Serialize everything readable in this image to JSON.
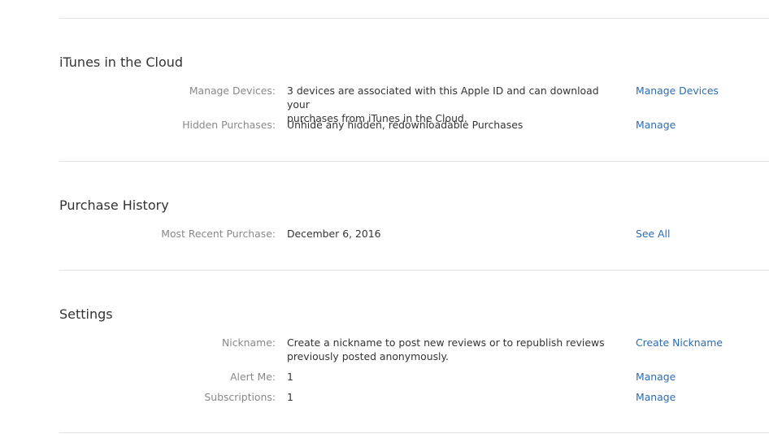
{
  "sections": {
    "itunes_cloud": {
      "title": "iTunes in the Cloud",
      "rows": [
        {
          "label": "Manage Devices:",
          "value_line1": "3 devices are associated with this Apple ID and can download your",
          "value_line2": "purchases from iTunes in the Cloud.",
          "link": "Manage Devices"
        },
        {
          "label": "Hidden Purchases:",
          "value_line1": "Unhide any hidden, redownloadable Purchases",
          "link": "Manage"
        }
      ]
    },
    "purchase_history": {
      "title": "Purchase History",
      "rows": [
        {
          "label": "Most Recent Purchase:",
          "value_line1": "December 6, 2016",
          "link": "See All"
        }
      ]
    },
    "settings": {
      "title": "Settings",
      "rows": [
        {
          "label": "Nickname:",
          "value_line1": "Create a nickname to post new reviews or to republish reviews",
          "value_line2": "previously posted anonymously.",
          "link": "Create Nickname"
        },
        {
          "label": "Alert Me:",
          "value_line1": "1",
          "link": "Manage"
        },
        {
          "label": "Subscriptions:",
          "value_line1": "1",
          "link": "Manage"
        }
      ]
    }
  },
  "colors": {
    "link": "#2c6cb0",
    "label": "#888888",
    "text": "#333333",
    "divider": "#e2e2e2"
  }
}
